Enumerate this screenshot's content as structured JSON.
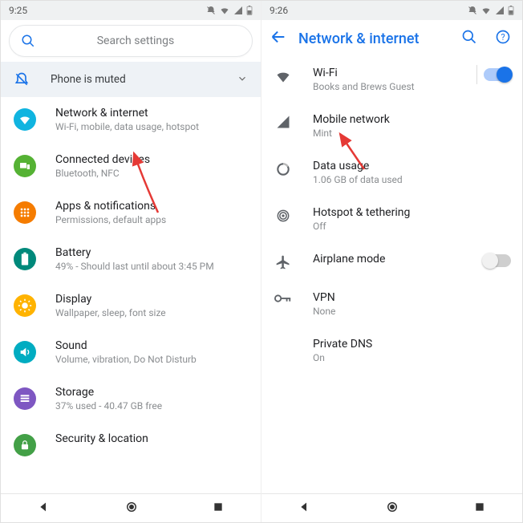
{
  "left": {
    "status_time": "9:25",
    "search_placeholder": "Search settings",
    "mute_label": "Phone is muted",
    "items": [
      {
        "title": "Network & internet",
        "sub": "Wi-Fi, mobile, data usage, hotspot",
        "bg": "#10b4e0",
        "icon": "wifi"
      },
      {
        "title": "Connected devices",
        "sub": "Bluetooth, NFC",
        "bg": "#55b234",
        "icon": "devices"
      },
      {
        "title": "Apps & notifications",
        "sub": "Permissions, default apps",
        "bg": "#f57c00",
        "icon": "apps"
      },
      {
        "title": "Battery",
        "sub": "49% - Should last until about 3:45 PM",
        "bg": "#00897b",
        "icon": "battery"
      },
      {
        "title": "Display",
        "sub": "Wallpaper, sleep, font size",
        "bg": "#ffb300",
        "icon": "display"
      },
      {
        "title": "Sound",
        "sub": "Volume, vibration, Do Not Disturb",
        "bg": "#00acc1",
        "icon": "sound"
      },
      {
        "title": "Storage",
        "sub": "37% used - 40.47 GB free",
        "bg": "#7e57c2",
        "icon": "storage"
      },
      {
        "title": "Security & location",
        "sub": "",
        "bg": "#43a047",
        "icon": "security"
      }
    ]
  },
  "right": {
    "status_time": "9:26",
    "header_title": "Network & internet",
    "items": [
      {
        "title": "Wi-Fi",
        "sub": "Books and Brews Guest",
        "icon": "wifi",
        "toggle": "on"
      },
      {
        "title": "Mobile network",
        "sub": "Mint",
        "icon": "signal"
      },
      {
        "title": "Data usage",
        "sub": "1.06 GB of data used",
        "icon": "datacircle"
      },
      {
        "title": "Hotspot & tethering",
        "sub": "Off",
        "icon": "hotspot"
      },
      {
        "title": "Airplane mode",
        "sub": "",
        "icon": "airplane",
        "toggle": "off"
      },
      {
        "title": "VPN",
        "sub": "None",
        "icon": "vpn"
      },
      {
        "title": "Private DNS",
        "sub": "On",
        "icon": ""
      }
    ]
  }
}
